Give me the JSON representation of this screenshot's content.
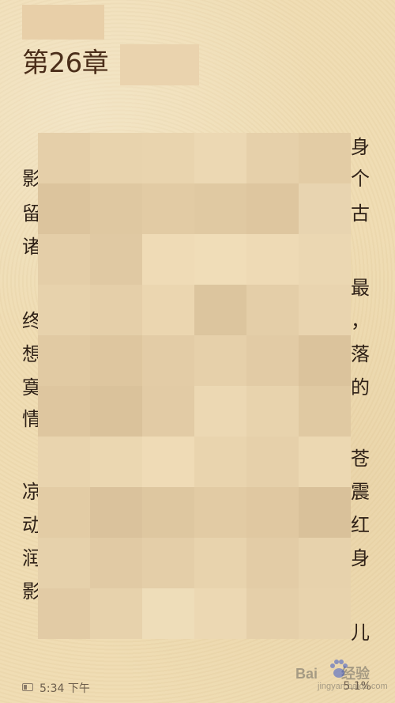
{
  "chapter": {
    "title": "第26章"
  },
  "text_fragments": [
    {
      "key": "l1r",
      "text": "身"
    },
    {
      "key": "l2l",
      "text": "影"
    },
    {
      "key": "l2r",
      "text": "个"
    },
    {
      "key": "l3l",
      "text": "留"
    },
    {
      "key": "l3r",
      "text": "古"
    },
    {
      "key": "l4l",
      "text": "诸"
    },
    {
      "key": "l5r",
      "text": "最"
    },
    {
      "key": "l6l",
      "text": "终"
    },
    {
      "key": "l6r",
      "text": "，"
    },
    {
      "key": "l7l",
      "text": "想"
    },
    {
      "key": "l7r",
      "text": "落"
    },
    {
      "key": "l8l",
      "text": "寞"
    },
    {
      "key": "l8r",
      "text": "的"
    },
    {
      "key": "l9l",
      "text": "情"
    },
    {
      "key": "l10r",
      "text": "苍"
    },
    {
      "key": "l11l",
      "text": "凉"
    },
    {
      "key": "l11r",
      "text": "震"
    },
    {
      "key": "l12l",
      "text": "动"
    },
    {
      "key": "l12r",
      "text": "红"
    },
    {
      "key": "l13l",
      "text": "润"
    },
    {
      "key": "l13r",
      "text": "身"
    },
    {
      "key": "l14l",
      "text": "影"
    },
    {
      "key": "l15r",
      "text": "儿"
    }
  ],
  "status_bar": {
    "time": "5:34 下午",
    "progress": "5.1%"
  },
  "watermark": {
    "brand": "Bai",
    "brand_tail": "经验",
    "url": "jingyan.baidu.com"
  },
  "colors": {
    "paper": "#efdcb2",
    "title": "#4b2e1a",
    "text": "#2f2117",
    "mosaic_dark": "#dcc59e",
    "mosaic_light": "#f1ddb8"
  },
  "mosaic_tones": [
    [
      "#e5cfa9",
      "#e8d3ad",
      "#e9d4ae",
      "#ecd8b3",
      "#e6d0aa",
      "#e3cca5"
    ],
    [
      "#dcc49d",
      "#dfc8a1",
      "#e2cba4",
      "#e0c9a2",
      "#dec69f",
      "#e8d4b0"
    ],
    [
      "#e4cea8",
      "#e0c9a3",
      "#efdbb6",
      "#f0ddb8",
      "#eedab5",
      "#ebd7b2"
    ],
    [
      "#e7d2ac",
      "#e5cfa9",
      "#ebd6b0",
      "#dcc59e",
      "#e4cea8",
      "#e9d4af"
    ],
    [
      "#e1caa3",
      "#dec69f",
      "#e3cca6",
      "#e6d0aa",
      "#e2cba5",
      "#dbc39c"
    ],
    [
      "#dec69f",
      "#dac29b",
      "#e2cba5",
      "#ecd8b3",
      "#e8d3ad",
      "#e0c9a2"
    ],
    [
      "#e9d4ae",
      "#ebd7b1",
      "#efdbb6",
      "#e9d4ae",
      "#e6d0aa",
      "#ecd8b2"
    ],
    [
      "#e3cca5",
      "#dac29c",
      "#dec7a0",
      "#e2cba4",
      "#e0c8a1",
      "#d9c19a"
    ],
    [
      "#e6d1ab",
      "#e1caa4",
      "#e4cea8",
      "#e8d3ad",
      "#e3cca6",
      "#e7d2ac"
    ],
    [
      "#e2cba5",
      "#e7d2ac",
      "#eeddb9",
      "#ecd8b3",
      "#e5cfa9",
      "#e8d3ad"
    ]
  ]
}
